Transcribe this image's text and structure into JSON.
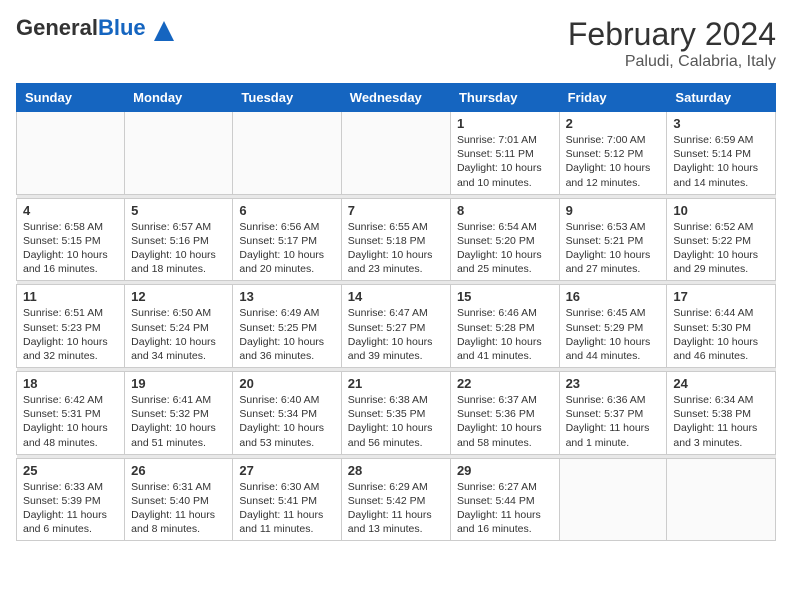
{
  "logo": {
    "general": "General",
    "blue": "Blue"
  },
  "title": "February 2024",
  "subtitle": "Paludi, Calabria, Italy",
  "days": [
    "Sunday",
    "Monday",
    "Tuesday",
    "Wednesday",
    "Thursday",
    "Friday",
    "Saturday"
  ],
  "weeks": [
    [
      {
        "num": "",
        "info": ""
      },
      {
        "num": "",
        "info": ""
      },
      {
        "num": "",
        "info": ""
      },
      {
        "num": "",
        "info": ""
      },
      {
        "num": "1",
        "info": "Sunrise: 7:01 AM\nSunset: 5:11 PM\nDaylight: 10 hours\nand 10 minutes."
      },
      {
        "num": "2",
        "info": "Sunrise: 7:00 AM\nSunset: 5:12 PM\nDaylight: 10 hours\nand 12 minutes."
      },
      {
        "num": "3",
        "info": "Sunrise: 6:59 AM\nSunset: 5:14 PM\nDaylight: 10 hours\nand 14 minutes."
      }
    ],
    [
      {
        "num": "4",
        "info": "Sunrise: 6:58 AM\nSunset: 5:15 PM\nDaylight: 10 hours\nand 16 minutes."
      },
      {
        "num": "5",
        "info": "Sunrise: 6:57 AM\nSunset: 5:16 PM\nDaylight: 10 hours\nand 18 minutes."
      },
      {
        "num": "6",
        "info": "Sunrise: 6:56 AM\nSunset: 5:17 PM\nDaylight: 10 hours\nand 20 minutes."
      },
      {
        "num": "7",
        "info": "Sunrise: 6:55 AM\nSunset: 5:18 PM\nDaylight: 10 hours\nand 23 minutes."
      },
      {
        "num": "8",
        "info": "Sunrise: 6:54 AM\nSunset: 5:20 PM\nDaylight: 10 hours\nand 25 minutes."
      },
      {
        "num": "9",
        "info": "Sunrise: 6:53 AM\nSunset: 5:21 PM\nDaylight: 10 hours\nand 27 minutes."
      },
      {
        "num": "10",
        "info": "Sunrise: 6:52 AM\nSunset: 5:22 PM\nDaylight: 10 hours\nand 29 minutes."
      }
    ],
    [
      {
        "num": "11",
        "info": "Sunrise: 6:51 AM\nSunset: 5:23 PM\nDaylight: 10 hours\nand 32 minutes."
      },
      {
        "num": "12",
        "info": "Sunrise: 6:50 AM\nSunset: 5:24 PM\nDaylight: 10 hours\nand 34 minutes."
      },
      {
        "num": "13",
        "info": "Sunrise: 6:49 AM\nSunset: 5:25 PM\nDaylight: 10 hours\nand 36 minutes."
      },
      {
        "num": "14",
        "info": "Sunrise: 6:47 AM\nSunset: 5:27 PM\nDaylight: 10 hours\nand 39 minutes."
      },
      {
        "num": "15",
        "info": "Sunrise: 6:46 AM\nSunset: 5:28 PM\nDaylight: 10 hours\nand 41 minutes."
      },
      {
        "num": "16",
        "info": "Sunrise: 6:45 AM\nSunset: 5:29 PM\nDaylight: 10 hours\nand 44 minutes."
      },
      {
        "num": "17",
        "info": "Sunrise: 6:44 AM\nSunset: 5:30 PM\nDaylight: 10 hours\nand 46 minutes."
      }
    ],
    [
      {
        "num": "18",
        "info": "Sunrise: 6:42 AM\nSunset: 5:31 PM\nDaylight: 10 hours\nand 48 minutes."
      },
      {
        "num": "19",
        "info": "Sunrise: 6:41 AM\nSunset: 5:32 PM\nDaylight: 10 hours\nand 51 minutes."
      },
      {
        "num": "20",
        "info": "Sunrise: 6:40 AM\nSunset: 5:34 PM\nDaylight: 10 hours\nand 53 minutes."
      },
      {
        "num": "21",
        "info": "Sunrise: 6:38 AM\nSunset: 5:35 PM\nDaylight: 10 hours\nand 56 minutes."
      },
      {
        "num": "22",
        "info": "Sunrise: 6:37 AM\nSunset: 5:36 PM\nDaylight: 10 hours\nand 58 minutes."
      },
      {
        "num": "23",
        "info": "Sunrise: 6:36 AM\nSunset: 5:37 PM\nDaylight: 11 hours\nand 1 minute."
      },
      {
        "num": "24",
        "info": "Sunrise: 6:34 AM\nSunset: 5:38 PM\nDaylight: 11 hours\nand 3 minutes."
      }
    ],
    [
      {
        "num": "25",
        "info": "Sunrise: 6:33 AM\nSunset: 5:39 PM\nDaylight: 11 hours\nand 6 minutes."
      },
      {
        "num": "26",
        "info": "Sunrise: 6:31 AM\nSunset: 5:40 PM\nDaylight: 11 hours\nand 8 minutes."
      },
      {
        "num": "27",
        "info": "Sunrise: 6:30 AM\nSunset: 5:41 PM\nDaylight: 11 hours\nand 11 minutes."
      },
      {
        "num": "28",
        "info": "Sunrise: 6:29 AM\nSunset: 5:42 PM\nDaylight: 11 hours\nand 13 minutes."
      },
      {
        "num": "29",
        "info": "Sunrise: 6:27 AM\nSunset: 5:44 PM\nDaylight: 11 hours\nand 16 minutes."
      },
      {
        "num": "",
        "info": ""
      },
      {
        "num": "",
        "info": ""
      }
    ]
  ]
}
